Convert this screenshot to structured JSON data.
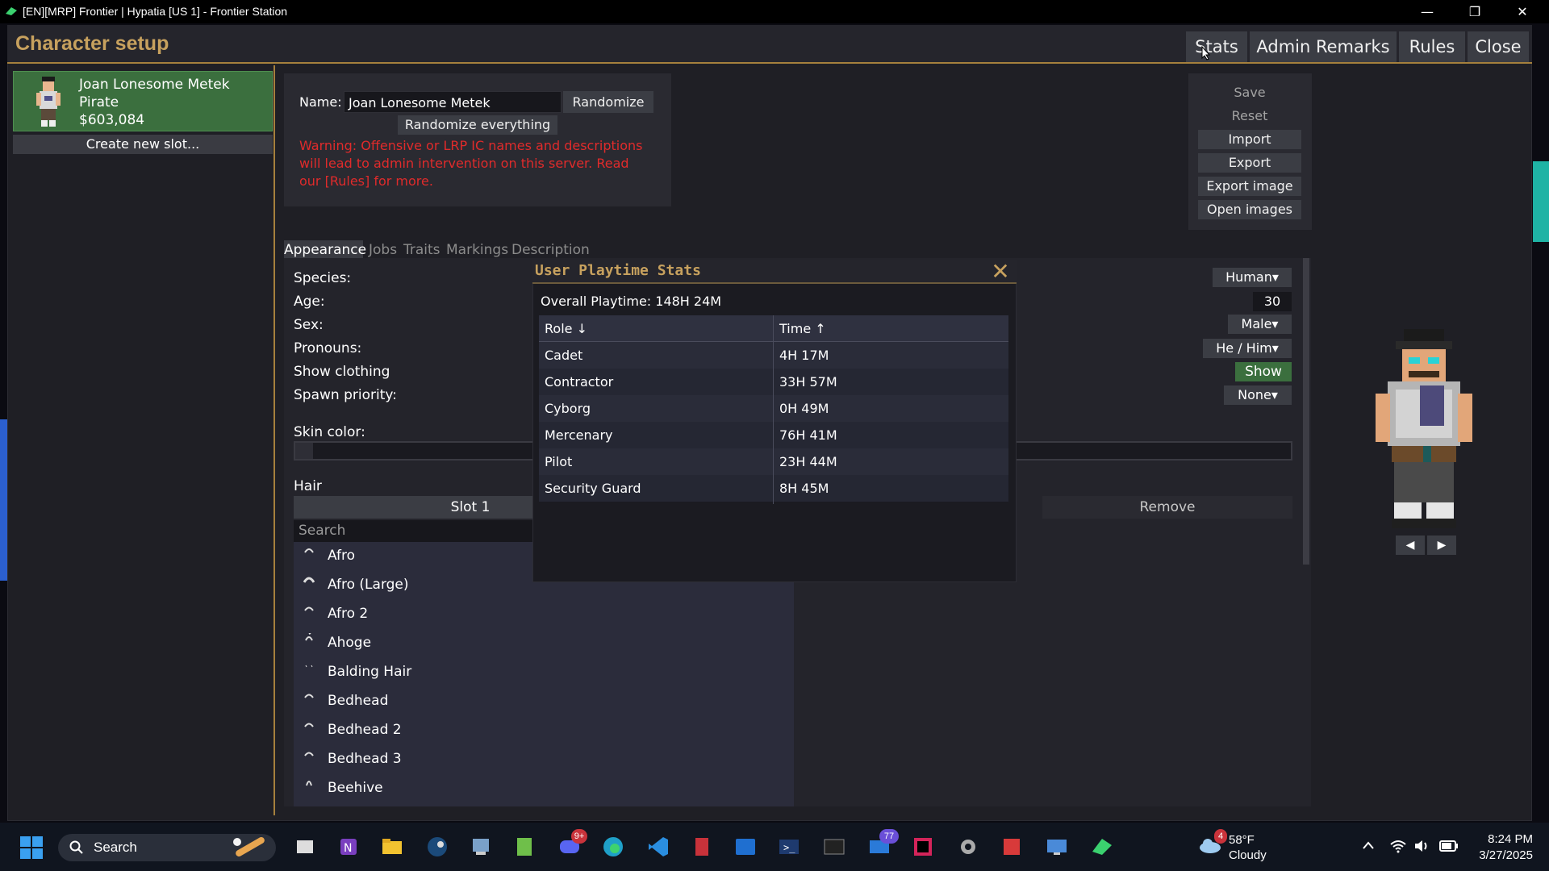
{
  "window": {
    "title": "[EN][MRP] Frontier | Hypatia [US 1] - Frontier Station",
    "minimize": "—",
    "maximize": "❐",
    "close": "✕"
  },
  "header": {
    "title": "Character setup",
    "buttons": [
      "Stats",
      "Admin Remarks",
      "Rules",
      "Close"
    ]
  },
  "slots": {
    "active": {
      "name": "Joan Lonesome Metek",
      "job": "Pirate",
      "money": "$603,084"
    },
    "create_label": "Create new slot..."
  },
  "name_section": {
    "label": "Name:",
    "value": "Joan Lonesome Metek",
    "randomize": "Randomize",
    "randomize_everything": "Randomize everything",
    "warning": "Warning: Offensive or LRP IC names and descriptions will lead to admin intervention on this server. Read our [Rules] for more."
  },
  "actions": {
    "save": "Save",
    "reset": "Reset",
    "import": "Import",
    "export": "Export",
    "export_image": "Export image",
    "open_images": "Open images"
  },
  "tabs": [
    "Appearance",
    "Jobs",
    "Traits",
    "Markings",
    "Description"
  ],
  "appearance": {
    "species_label": "Species:",
    "age_label": "Age:",
    "sex_label": "Sex:",
    "pronouns_label": "Pronouns:",
    "show_clothing_label": "Show clothing",
    "spawn_priority_label": "Spawn priority:",
    "skin_color_label": "Skin color:",
    "hair_label": "Hair",
    "species": "Human▾",
    "age": "30",
    "sex": "Male▾",
    "pronouns": "He / Him▾",
    "show_clothing": "Show",
    "spawn_priority": "None▾",
    "slot1": "Slot 1",
    "remove": "Remove",
    "search_placeholder": "Search",
    "hair_styles": [
      "Afro",
      "Afro (Large)",
      "Afro 2",
      "Ahoge",
      "Balding Hair",
      "Bedhead",
      "Bedhead 2",
      "Bedhead 3",
      "Beehive"
    ]
  },
  "preview": {
    "rotate_left": "◀",
    "rotate_right": "▶"
  },
  "playtime_popup": {
    "title": "User Playtime Stats",
    "close": "✕",
    "overall": "Overall Playtime: 148H 24M",
    "headers": [
      "Role ↓",
      "Time ↑"
    ],
    "rows": [
      [
        "Cadet",
        "4H 17M"
      ],
      [
        "Contractor",
        "33H 57M"
      ],
      [
        "Cyborg",
        "0H 49M"
      ],
      [
        "Mercenary",
        "76H 41M"
      ],
      [
        "Pilot",
        "23H 44M"
      ],
      [
        "Security Guard",
        "8H 45M"
      ]
    ]
  },
  "taskbar": {
    "search": "Search",
    "discord_badge": "9+",
    "mail_badge": "77",
    "weather_badge": "4",
    "temperature": "58°F",
    "condition": "Cloudy",
    "time": "8:24 PM",
    "date": "3/27/2025"
  },
  "colors": {
    "accent_gold": "#c7a15e",
    "active_green": "#3b6f3e",
    "warning_red": "#e02b2b"
  }
}
